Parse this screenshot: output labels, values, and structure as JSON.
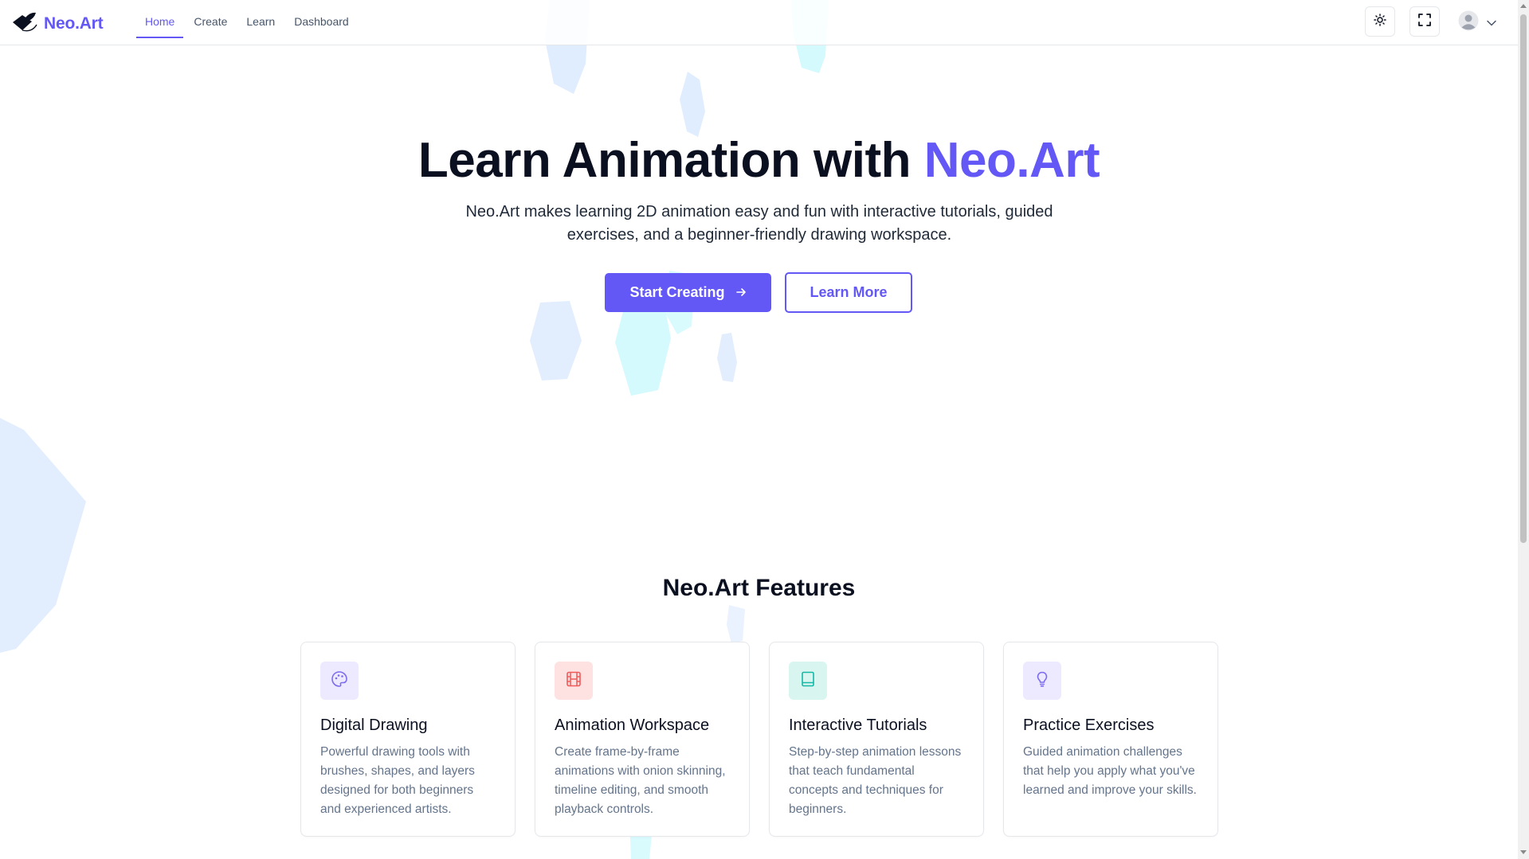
{
  "header": {
    "brand": "Neo.Art",
    "nav": [
      {
        "label": "Home",
        "active": true
      },
      {
        "label": "Create",
        "active": false
      },
      {
        "label": "Learn",
        "active": false
      },
      {
        "label": "Dashboard",
        "active": false
      }
    ],
    "icons": [
      "brush-logo-icon",
      "sun-icon",
      "fullscreen-icon",
      "user-avatar-icon",
      "chevron-down-icon"
    ]
  },
  "hero": {
    "title_main": "Learn Animation with ",
    "title_accent": "Neo.Art",
    "subtitle": "Neo.Art makes learning 2D animation easy and fun with interactive tutorials, guided exercises, and a beginner-friendly drawing workspace.",
    "primary_button": "Start Creating",
    "secondary_button": "Learn More"
  },
  "features": {
    "heading": "Neo.Art Features",
    "cards": [
      {
        "icon": "palette-icon",
        "title": "Digital Drawing",
        "description": "Powerful drawing tools with brushes, shapes, and layers designed for both beginners and experienced artists.",
        "icon_bg": "#ede9fe",
        "icon_color": "#7c6cf0"
      },
      {
        "icon": "film-icon",
        "title": "Animation Workspace",
        "description": "Create frame-by-frame animations with onion skinning, timeline editing, and smooth playback controls.",
        "icon_bg": "#fee2e2",
        "icon_color": "#ef5b5b"
      },
      {
        "icon": "book-icon",
        "title": "Interactive Tutorials",
        "description": "Step-by-step animation lessons that teach fundamental concepts and techniques for beginners.",
        "icon_bg": "#d9f5ef",
        "icon_color": "#14b8a6"
      },
      {
        "icon": "lightbulb-icon",
        "title": "Practice Exercises",
        "description": "Guided animation challenges that help you apply what you've learned and improve your skills.",
        "icon_bg": "#ede9fe",
        "icon_color": "#7c6cf0"
      }
    ]
  },
  "colors": {
    "accent": "#6358f5",
    "text_dark": "#0b1020",
    "text_muted": "#64748b"
  }
}
